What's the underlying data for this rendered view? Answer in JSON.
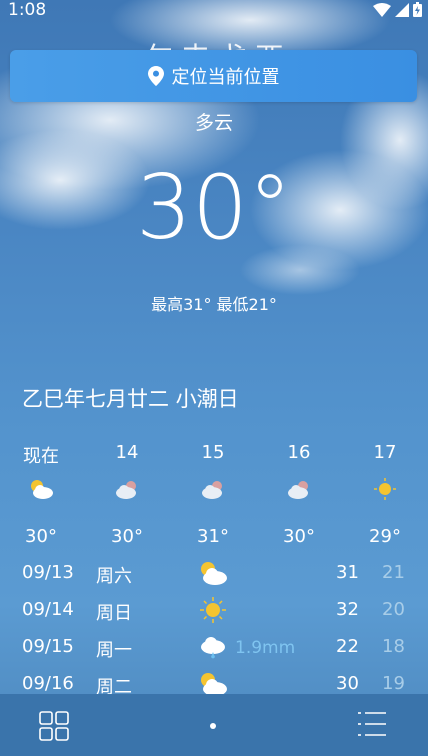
{
  "status": {
    "time": "1:08"
  },
  "header": {
    "city_partial": "乍 丰 戈 西",
    "locate_label": "定位当前位置"
  },
  "current": {
    "condition": "多云",
    "temperature": "30°",
    "hilo": "最高31° 最低21°"
  },
  "lunar_date": "乙巳年七月廿二 小潮日",
  "hourly": [
    {
      "label": "现在",
      "icon": "partly-cloudy-icon",
      "temp": "30°"
    },
    {
      "label": "14",
      "icon": "partly-cloudy-night-icon",
      "temp": "30°"
    },
    {
      "label": "15",
      "icon": "partly-cloudy-night-icon",
      "temp": "31°"
    },
    {
      "label": "16",
      "icon": "partly-cloudy-night-icon",
      "temp": "30°"
    },
    {
      "label": "17",
      "icon": "sun-icon",
      "temp": "29°"
    }
  ],
  "daily": [
    {
      "date": "09/13",
      "weekday": "周六",
      "icon": "partly-cloudy-icon",
      "precip": "",
      "high": "31",
      "low": "21"
    },
    {
      "date": "09/14",
      "weekday": "周日",
      "icon": "sun-icon",
      "precip": "",
      "high": "32",
      "low": "20"
    },
    {
      "date": "09/15",
      "weekday": "周一",
      "icon": "rain-icon",
      "precip": "1.9mm",
      "high": "22",
      "low": "18"
    },
    {
      "date": "09/16",
      "weekday": "周二",
      "icon": "partly-cloudy-icon",
      "precip": "",
      "high": "30",
      "low": "19"
    }
  ],
  "colors": {
    "accent_button": "#3a8fe2",
    "bottom_bar": "#3a74ab",
    "precip_text": "#7fc4f0"
  }
}
